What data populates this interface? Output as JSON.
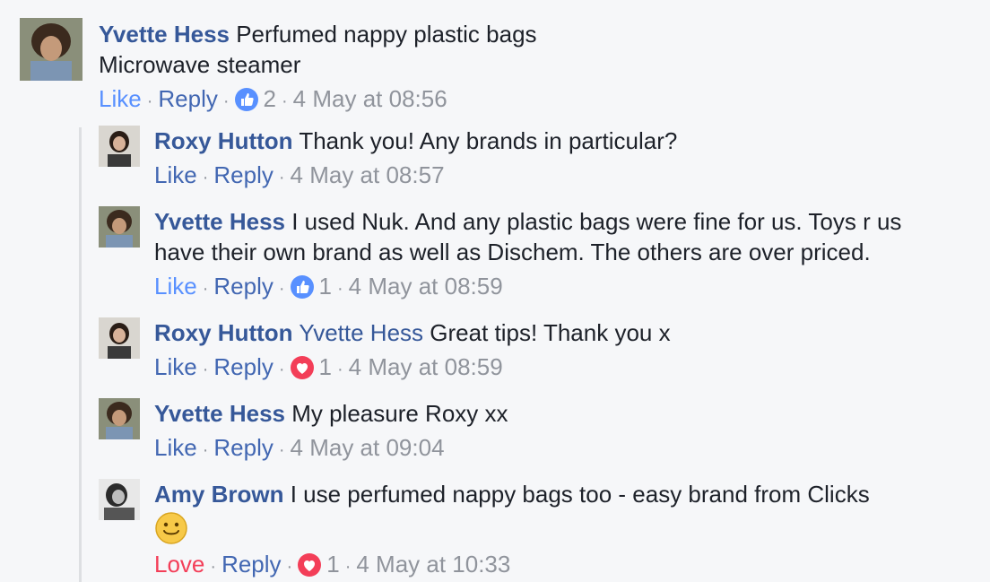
{
  "top_comment": {
    "author": "Yvette Hess",
    "text_line1": "Perfumed nappy plastic bags",
    "text_line2": "Microwave steamer",
    "like_label": "Like",
    "reply_label": "Reply",
    "reaction_count": "2",
    "timestamp": "4 May at 08:56"
  },
  "replies": [
    {
      "author": "Roxy Hutton",
      "text": "Thank you! Any brands in particular?",
      "like_label": "Like",
      "reply_label": "Reply",
      "timestamp": "4 May at 08:57"
    },
    {
      "author": "Yvette Hess",
      "text_line1": "I used Nuk. And any plastic bags were fine for us. Toys r us",
      "text_line2": "have their own brand as well as Dischem. The others are over priced.",
      "like_label": "Like",
      "reply_label": "Reply",
      "reaction_count": "1",
      "timestamp": "4 May at 08:59"
    },
    {
      "author": "Roxy Hutton",
      "mention": "Yvette Hess",
      "text": "Great tips! Thank you x",
      "like_label": "Like",
      "reply_label": "Reply",
      "reaction_count": "1",
      "timestamp": "4 May at 08:59"
    },
    {
      "author": "Yvette Hess",
      "text": "My pleasure Roxy xx",
      "like_label": "Like",
      "reply_label": "Reply",
      "timestamp": "4 May at 09:04"
    },
    {
      "author": "Amy Brown",
      "text": "I use perfumed nappy bags too - easy brand from Clicks",
      "love_label": "Love",
      "reply_label": "Reply",
      "reaction_count": "1",
      "timestamp": "4 May at 10:33"
    }
  ],
  "colors": {
    "name": "#365899",
    "action": "#4267b2",
    "liked": "#5890ff",
    "loved": "#f33e58",
    "meta": "#90949c",
    "background": "#f6f7f9"
  },
  "icons": [
    "like-reaction-icon",
    "love-reaction-icon",
    "smile-emoji-icon"
  ]
}
